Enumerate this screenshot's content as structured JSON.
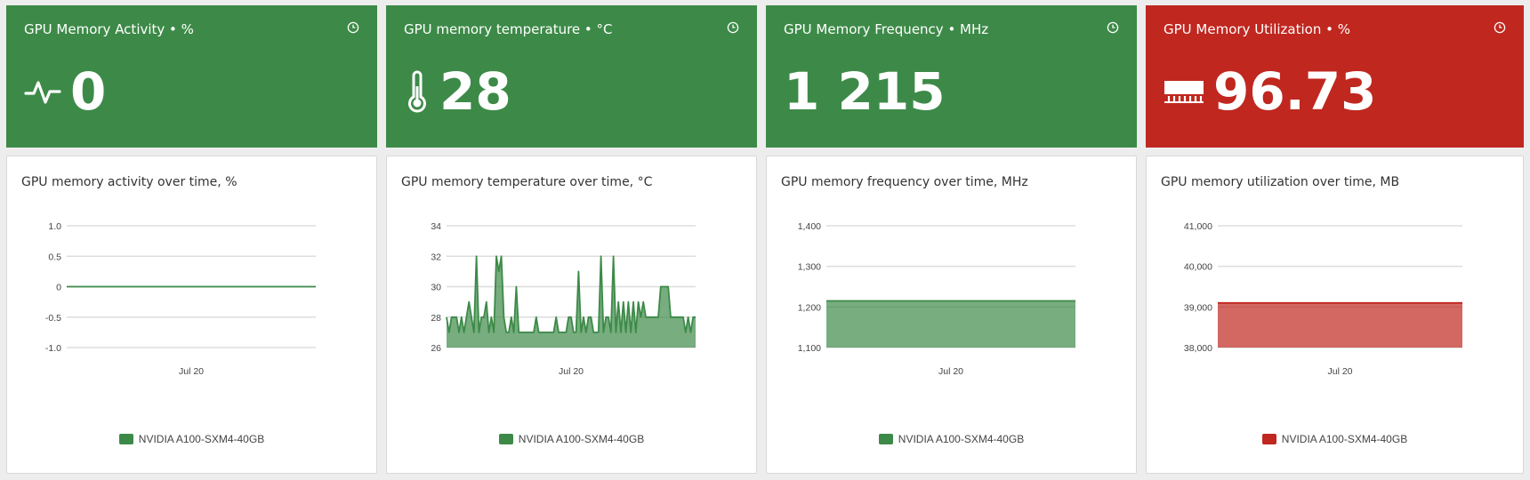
{
  "colors": {
    "green": "#3d8a48",
    "red": "#c0271f",
    "grid": "#dddddd"
  },
  "stats": [
    {
      "title": "GPU Memory Activity • %",
      "value": "0",
      "icon": "activity-pulse-icon",
      "status": "green"
    },
    {
      "title": "GPU memory temperature • °C",
      "value": "28",
      "icon": "thermometer-icon",
      "status": "green"
    },
    {
      "title": "GPU Memory Frequency • MHz",
      "value": "1 215",
      "icon": "",
      "status": "green"
    },
    {
      "title": "GPU Memory Utilization • %",
      "value": "96.73",
      "icon": "memory-module-icon",
      "status": "red"
    }
  ],
  "panels": [
    {
      "title": "GPU memory activity over time, %",
      "legend": "NVIDIA A100-SXM4-40GB"
    },
    {
      "title": "GPU memory temperature over time, °C",
      "legend": "NVIDIA A100-SXM4-40GB"
    },
    {
      "title": "GPU memory frequency over time, MHz",
      "legend": "NVIDIA A100-SXM4-40GB"
    },
    {
      "title": "GPU memory utilization over time, MB",
      "legend": "NVIDIA A100-SXM4-40GB"
    }
  ],
  "chart_data": [
    {
      "type": "line",
      "title": "GPU memory activity over time, %",
      "x_tick": "Jul 20",
      "ylim": [
        -1.0,
        1.0
      ],
      "yticks": [
        "1.0",
        "0.5",
        "0",
        "-0.5",
        "-1.0"
      ],
      "series": [
        {
          "name": "NVIDIA A100-SXM4-40GB",
          "color": "#3d8a48",
          "values": [
            0,
            0,
            0,
            0,
            0,
            0,
            0,
            0,
            0,
            0
          ]
        }
      ]
    },
    {
      "type": "area",
      "title": "GPU memory temperature over time, °C",
      "x_tick": "Jul 20",
      "ylim": [
        26,
        34
      ],
      "yticks": [
        "34",
        "32",
        "30",
        "28",
        "26"
      ],
      "series": [
        {
          "name": "NVIDIA A100-SXM4-40GB",
          "color": "#3d8a48",
          "values": [
            28,
            27,
            28,
            28,
            28,
            27,
            28,
            27,
            28,
            29,
            28,
            27,
            32,
            27,
            28,
            28,
            29,
            27,
            28,
            27,
            32,
            31,
            32,
            28,
            27,
            27,
            28,
            27,
            30,
            27,
            27,
            27,
            27,
            27,
            27,
            27,
            28,
            27,
            27,
            27,
            27,
            27,
            27,
            27,
            28,
            27,
            27,
            27,
            27,
            28,
            28,
            27,
            27,
            31,
            27,
            28,
            27,
            28,
            28,
            27,
            27,
            27,
            32,
            27,
            28,
            28,
            27,
            32,
            27,
            29,
            27,
            29,
            27,
            29,
            27,
            29,
            27,
            29,
            28,
            29,
            28,
            28,
            28,
            28,
            28,
            28,
            30,
            30,
            30,
            30,
            28,
            28,
            28,
            28,
            28,
            28,
            27,
            28,
            27,
            28,
            28
          ]
        }
      ]
    },
    {
      "type": "area",
      "title": "GPU memory frequency over time, MHz",
      "x_tick": "Jul 20",
      "ylim": [
        1100,
        1400
      ],
      "yticks": [
        "1,400",
        "1,300",
        "1,200",
        "1,100"
      ],
      "series": [
        {
          "name": "NVIDIA A100-SXM4-40GB",
          "color": "#3d8a48",
          "values": [
            1215,
            1215,
            1215,
            1215,
            1215,
            1215,
            1215,
            1215,
            1215,
            1215
          ]
        }
      ]
    },
    {
      "type": "area",
      "title": "GPU memory utilization over time, MB",
      "x_tick": "Jul 20",
      "ylim": [
        38000,
        41000
      ],
      "yticks": [
        "41,000",
        "40,000",
        "39,000",
        "38,000"
      ],
      "series": [
        {
          "name": "NVIDIA A100-SXM4-40GB",
          "color": "#c0271f",
          "values": [
            39100,
            39100,
            39100,
            39100,
            39100,
            39100,
            39100,
            39100,
            39100,
            39100
          ]
        }
      ]
    }
  ]
}
